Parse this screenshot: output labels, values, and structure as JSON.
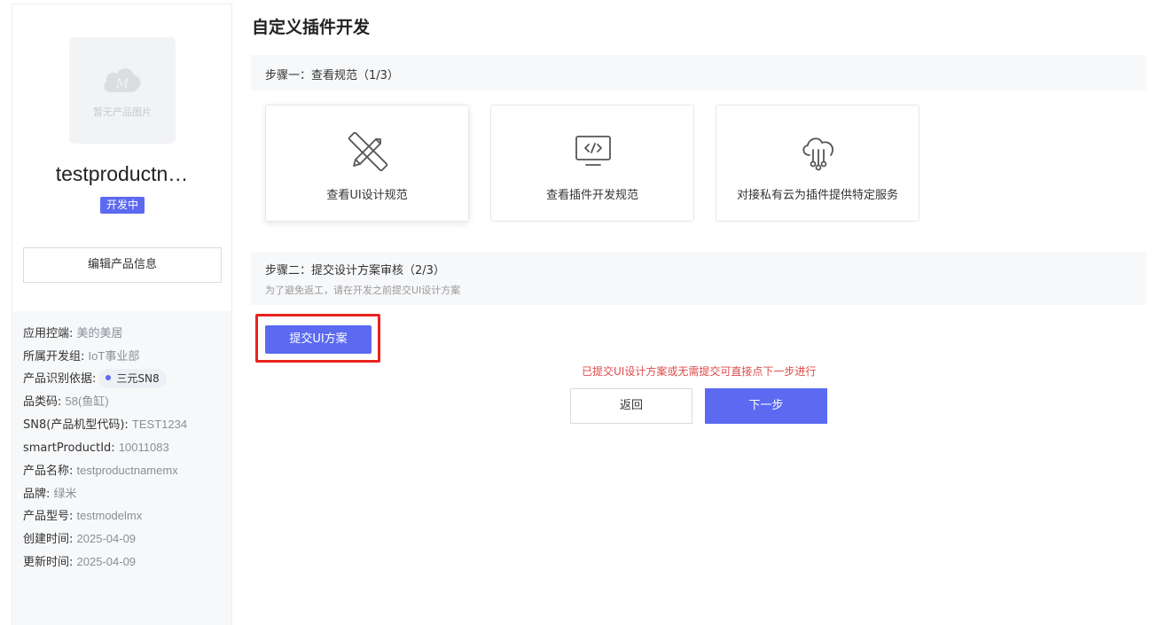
{
  "sidebar": {
    "image_placeholder": "暂无产品图片",
    "product_name": "testproductn…",
    "status": "开发中",
    "edit_button": "编辑产品信息",
    "info": [
      {
        "label": "应用控端:",
        "value": "美的美居"
      },
      {
        "label": "所属开发组:",
        "value": "IoT事业部"
      },
      {
        "label": "产品识别依据:",
        "value": "三元SN8"
      },
      {
        "label": "品类码:",
        "value": "58(鱼缸)"
      },
      {
        "label": "SN8(产品机型代码):",
        "value": "TEST1234"
      },
      {
        "label": "smartProductId:",
        "value": "10011083"
      },
      {
        "label": "产品名称:",
        "value": "testproductnamemx"
      },
      {
        "label": "品牌:",
        "value": "绿米"
      },
      {
        "label": "产品型号:",
        "value": "testmodelmx"
      },
      {
        "label": "创建时间:",
        "value": "2025-04-09"
      },
      {
        "label": "更新时间:",
        "value": "2025-04-09"
      }
    ]
  },
  "main": {
    "title": "自定义插件开发",
    "step1_title": "步骤一：查看规范（1/3）",
    "cards": [
      {
        "label": "查看UI设计规范",
        "icon": "design-tools-icon"
      },
      {
        "label": "查看插件开发规范",
        "icon": "code-monitor-icon"
      },
      {
        "label": "对接私有云为插件提供特定服务",
        "icon": "cloud-network-icon"
      }
    ],
    "step2_title": "步骤二：提交设计方案审核（2/3）",
    "step2_subtitle": "为了避免返工，请在开发之前提交UI设计方案",
    "submit_button": "提交UI方案",
    "notice": "已提交UI设计方案或无需提交可直接点下一步进行",
    "back_button": "返回",
    "next_button": "下一步"
  },
  "colors": {
    "accent": "#5b6af0",
    "highlight_border": "#e8231f",
    "notice_text": "#e04a4a"
  }
}
